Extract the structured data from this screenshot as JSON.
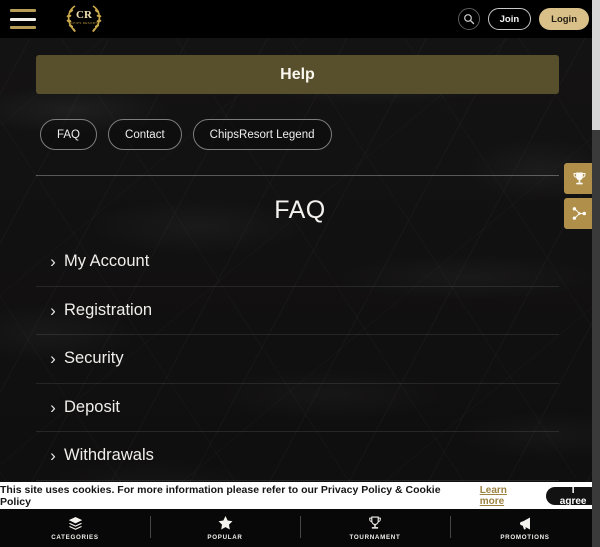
{
  "header": {
    "menu_icon": "hamburger-icon",
    "logo_text": "CR",
    "logo_sub": "CHIPS RESORT",
    "search_icon": "search-icon",
    "join_label": "Join",
    "login_label": "Login"
  },
  "banner": {
    "title": "Help"
  },
  "tabs": [
    {
      "label": "FAQ",
      "name": "tab-faq"
    },
    {
      "label": "Contact",
      "name": "tab-contact"
    },
    {
      "label": "ChipsResort Legend",
      "name": "tab-chipsresort-legend"
    }
  ],
  "section": {
    "title": "FAQ"
  },
  "accordion": {
    "chevron_icon": "chevron-right-icon",
    "items": [
      {
        "label": "My Account"
      },
      {
        "label": "Registration"
      },
      {
        "label": "Security"
      },
      {
        "label": "Deposit"
      },
      {
        "label": "Withdrawals"
      }
    ]
  },
  "side_tabs": [
    {
      "name": "side-tab-tournament",
      "icon": "trophy-icon"
    },
    {
      "name": "side-tab-bracket",
      "icon": "bracket-icon"
    }
  ],
  "cookie": {
    "text": "This site uses cookies. For more information please refer to our Privacy Policy & Cookie Policy",
    "link_label": "Learn more",
    "agree_label": "I agree"
  },
  "bottom_nav": [
    {
      "label": "CATEGORIES",
      "icon": "layers-icon",
      "name": "nav-categories"
    },
    {
      "label": "POPULAR",
      "icon": "star-icon",
      "name": "nav-popular"
    },
    {
      "label": "TOURNAMENT",
      "icon": "trophy-icon",
      "name": "nav-tournament"
    },
    {
      "label": "PROMOTIONS",
      "icon": "megaphone-icon",
      "name": "nav-promotions"
    }
  ],
  "colors": {
    "gold": "#d9c089",
    "banner_olive": "#584f2c",
    "side_tab_gold": "#b08f4b",
    "background_dark": "#141313",
    "link_gold": "#9c8242"
  }
}
